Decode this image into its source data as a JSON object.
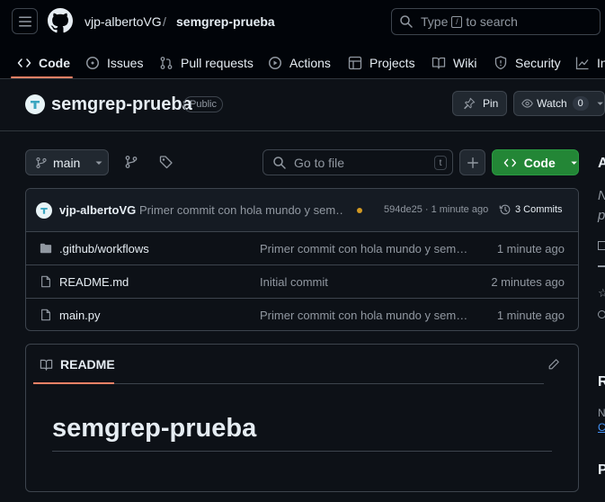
{
  "header": {
    "owner": "vjp-albertoVG",
    "separator": "/",
    "repo": "semgrep-prueba",
    "search": {
      "before": "Type",
      "key": "/",
      "after": "to search"
    }
  },
  "tabs": [
    {
      "label": "Code",
      "icon": "code-icon"
    },
    {
      "label": "Issues",
      "icon": "issue-icon"
    },
    {
      "label": "Pull requests",
      "icon": "pull-request-icon"
    },
    {
      "label": "Actions",
      "icon": "play-icon"
    },
    {
      "label": "Projects",
      "icon": "table-icon"
    },
    {
      "label": "Wiki",
      "icon": "book-icon"
    },
    {
      "label": "Security",
      "icon": "shield-icon"
    },
    {
      "label": "In",
      "icon": "graph-icon"
    }
  ],
  "repo_bar": {
    "name": "semgrep-prueba",
    "visibility": "Public",
    "pin_label": "Pin",
    "watch_label": "Watch",
    "watch_count": "0"
  },
  "toolbar": {
    "branch": "main",
    "file_search_placeholder": "Go to file",
    "file_search_key": "t",
    "code_button": "Code"
  },
  "latest_commit": {
    "author": "vjp-albertoVG",
    "message": "Primer commit con hola mundo y sem…",
    "hash_time": "594de25 · 1 minute ago",
    "commits_label": "3 Commits",
    "status_color": "#d29922"
  },
  "files": [
    {
      "name": ".github/workflows",
      "type": "folder",
      "message": "Primer commit con hola mundo y semgrep",
      "age": "1 minute ago"
    },
    {
      "name": "README.md",
      "type": "file",
      "message": "Initial commit",
      "age": "2 minutes ago"
    },
    {
      "name": "main.py",
      "type": "file",
      "message": "Primer commit con hola mundo y semgrep",
      "age": "1 minute ago"
    }
  ],
  "readme": {
    "tab_label": "README",
    "heading": "semgrep-prueba"
  },
  "sidebar": {
    "about_initial": "A",
    "desc_line1": "N",
    "desc_line2": "p",
    "releases_initial": "R",
    "releases_text": "N",
    "releases_link": "C",
    "packages_initial": "P"
  },
  "colors": {
    "accent": "#f78166",
    "primary_button": "#238636",
    "link": "#4493f8"
  }
}
